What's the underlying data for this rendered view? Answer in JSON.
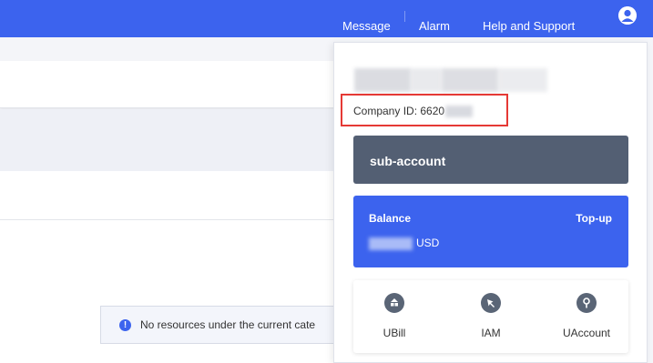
{
  "header": {
    "nav": [
      {
        "label": "Message"
      },
      {
        "label": "Alarm"
      },
      {
        "label": "Help and Support"
      }
    ],
    "icons": {
      "avatar": "user-avatar-icon"
    },
    "colors": {
      "accent": "#3c63ee"
    }
  },
  "notice": {
    "text": "No resources under the current cate",
    "icon": "info-icon"
  },
  "account_panel": {
    "company_id": "Company ID: 6620",
    "sub_account": "sub-account",
    "balance": {
      "label": "Balance",
      "topup": "Top-up",
      "currency": "USD"
    },
    "tools": [
      {
        "label": "UBill",
        "icon": "bill-icon"
      },
      {
        "label": "IAM",
        "icon": "cursor-icon"
      },
      {
        "label": "UAccount",
        "icon": "key-icon"
      }
    ],
    "colors": {
      "sub_account_bg": "#535f73",
      "balance_bg": "#3c63ee",
      "highlight": "#e53935"
    }
  }
}
